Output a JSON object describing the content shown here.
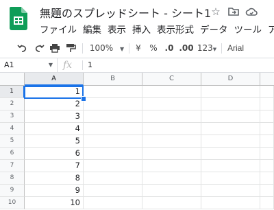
{
  "doc": {
    "title": "無題のスプレッドシート - シート1"
  },
  "menu": [
    "ファイル",
    "編集",
    "表示",
    "挿入",
    "表示形式",
    "データ",
    "ツール",
    "アド"
  ],
  "toolbar": {
    "zoom": "100%",
    "currency": "¥",
    "percent": "%",
    "dec_decrease": ".0",
    "dec_increase": ".00",
    "format_more": "123",
    "font": "Arial"
  },
  "formula": {
    "cell_ref": "A1",
    "fx": "fx",
    "value": "1"
  },
  "columns": [
    "A",
    "B",
    "C",
    "D"
  ],
  "rows": [
    "1",
    "2",
    "3",
    "4",
    "5",
    "6",
    "7",
    "8",
    "9",
    "10"
  ],
  "cells_a": [
    "1",
    "2",
    "3",
    "4",
    "5",
    "6",
    "7",
    "8",
    "9",
    "10"
  ],
  "colors": {
    "sheets_green": "#0f9d58",
    "accent": "#1a73e8"
  }
}
